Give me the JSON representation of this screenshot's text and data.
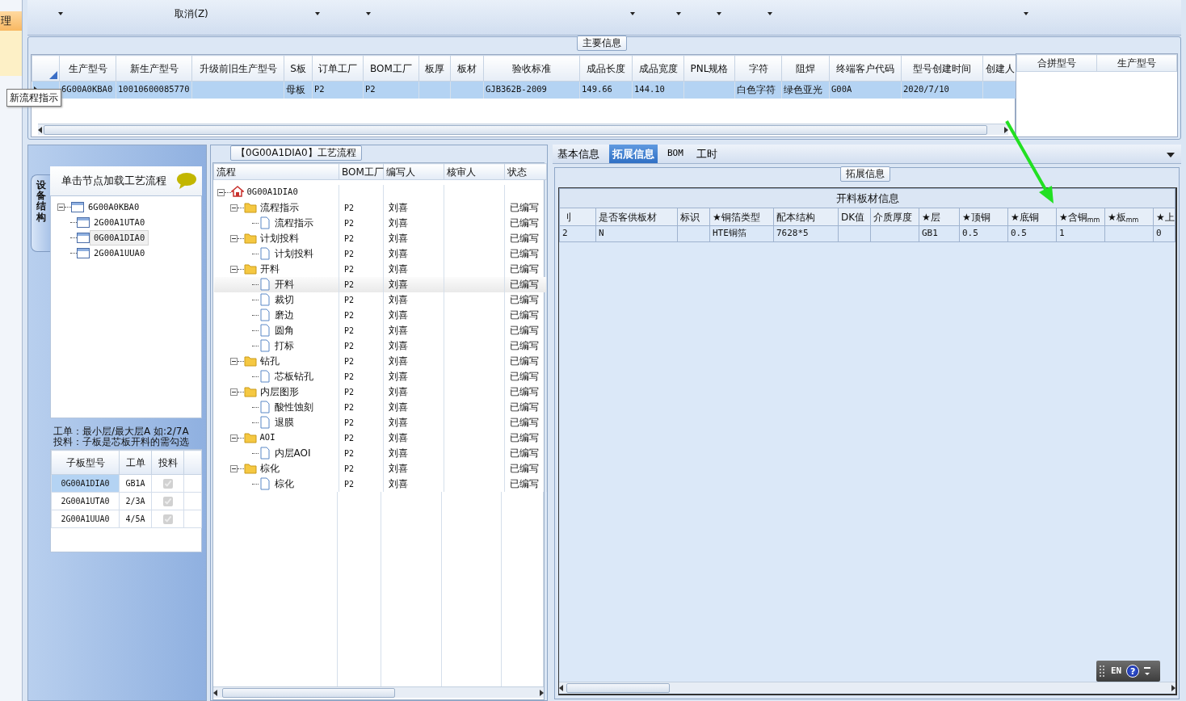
{
  "sidebar": {
    "items": [
      {
        "label": "理",
        "selected": true
      }
    ]
  },
  "toolbar": {
    "items": [
      {
        "label": "取消(Z)"
      }
    ]
  },
  "tooltip": "新流程指示",
  "main_info": {
    "title": "主要信息",
    "columns": [
      "生产型号",
      "新生产型号",
      "升级前旧生产型号",
      "S板",
      "订单工厂",
      "BOM工厂",
      "板厚",
      "板材",
      "验收标准",
      "成品长度",
      "成品宽度",
      "PNL规格",
      "字符",
      "阻焊",
      "终端客户代码",
      "型号创建时间",
      "创建人"
    ],
    "rows": [
      {
        "selected": true,
        "cells": [
          "6G00A0KBA0",
          "10010600085770",
          "",
          "母板",
          "P2",
          "P2",
          "",
          "",
          "GJB362B-2009",
          "149.66",
          "144.10",
          "",
          "白色字符",
          "绿色亚光",
          "G00A",
          "2020/7/10",
          ""
        ]
      }
    ]
  },
  "merge_table": {
    "columns": [
      "合拼型号",
      "生产型号"
    ]
  },
  "structure_panel": {
    "tab": "设备结构",
    "hint": "单击节点加载工艺流程",
    "tree": [
      {
        "label": "6G00A0KBA0",
        "expanded": true,
        "selected": false,
        "children": [
          {
            "label": "2G00A1UTA0",
            "selected": false
          },
          {
            "label": "0G00A1DIA0",
            "selected": true
          },
          {
            "label": "2G00A1UUA0",
            "selected": false
          }
        ]
      }
    ],
    "notes": [
      "工单：最小层/最大层A 如:2/7A",
      "投料：子板是芯板开料的需勾选"
    ],
    "sub_table": {
      "columns": [
        "子板型号",
        "工单",
        "投料"
      ],
      "rows": [
        {
          "cells": [
            "0G00A1DIA0",
            "GB1A"
          ],
          "checked": true,
          "disabled": true,
          "selected": true
        },
        {
          "cells": [
            "2G00A1UTA0",
            "2/3A"
          ],
          "checked": true,
          "disabled": true,
          "selected": false
        },
        {
          "cells": [
            "2G00A1UUA0",
            "4/5A"
          ],
          "checked": true,
          "disabled": true,
          "selected": false
        }
      ]
    }
  },
  "process_panel": {
    "title": "【0G00A1DIA0】工艺流程",
    "columns": [
      "流程",
      "BOM工厂",
      "编写人",
      "核审人",
      "状态"
    ],
    "tree": [
      {
        "label": "0G00A1DIA0",
        "kind": "root",
        "expanded": true,
        "selected": false,
        "children": [
          {
            "label": "流程指示",
            "kind": "folder",
            "bom": "P2",
            "writer": "刘喜",
            "status": "已编写",
            "expanded": true,
            "selected": false,
            "children": [
              {
                "label": "流程指示",
                "kind": "step",
                "bom": "P2",
                "writer": "刘喜",
                "status": "已编写",
                "selected": false
              }
            ]
          },
          {
            "label": "计划投料",
            "kind": "folder",
            "bom": "P2",
            "writer": "刘喜",
            "status": "已编写",
            "expanded": true,
            "selected": false,
            "children": [
              {
                "label": "计划投料",
                "kind": "step",
                "bom": "P2",
                "writer": "刘喜",
                "status": "已编写",
                "selected": false
              }
            ]
          },
          {
            "label": "开料",
            "kind": "folder",
            "bom": "P2",
            "writer": "刘喜",
            "status": "已编写",
            "expanded": true,
            "selected": false,
            "children": [
              {
                "label": "开料",
                "kind": "step",
                "bom": "P2",
                "writer": "刘喜",
                "status": "已编写",
                "selected": true
              },
              {
                "label": "裁切",
                "kind": "step",
                "bom": "P2",
                "writer": "刘喜",
                "status": "已编写",
                "selected": false
              },
              {
                "label": "磨边",
                "kind": "step",
                "bom": "P2",
                "writer": "刘喜",
                "status": "已编写",
                "selected": false
              },
              {
                "label": "圆角",
                "kind": "step",
                "bom": "P2",
                "writer": "刘喜",
                "status": "已编写",
                "selected": false
              },
              {
                "label": "打标",
                "kind": "step",
                "bom": "P2",
                "writer": "刘喜",
                "status": "已编写",
                "selected": false
              }
            ]
          },
          {
            "label": "钻孔",
            "kind": "folder",
            "bom": "P2",
            "writer": "刘喜",
            "status": "已编写",
            "expanded": true,
            "selected": false,
            "children": [
              {
                "label": "芯板钻孔",
                "kind": "step",
                "bom": "P2",
                "writer": "刘喜",
                "status": "已编写",
                "selected": false
              }
            ]
          },
          {
            "label": "内层图形",
            "kind": "folder",
            "bom": "P2",
            "writer": "刘喜",
            "status": "已编写",
            "expanded": true,
            "selected": false,
            "children": [
              {
                "label": "酸性蚀刻",
                "kind": "step",
                "bom": "P2",
                "writer": "刘喜",
                "status": "已编写",
                "selected": false
              },
              {
                "label": "退膜",
                "kind": "step",
                "bom": "P2",
                "writer": "刘喜",
                "status": "已编写",
                "selected": false
              }
            ]
          },
          {
            "label": "AOI",
            "kind": "folder",
            "bom": "P2",
            "writer": "刘喜",
            "status": "已编写",
            "expanded": true,
            "selected": false,
            "children": [
              {
                "label": "内层AOI",
                "kind": "step",
                "bom": "P2",
                "writer": "刘喜",
                "status": "已编写",
                "selected": false
              }
            ]
          },
          {
            "label": "棕化",
            "kind": "folder",
            "bom": "P2",
            "writer": "刘喜",
            "status": "已编写",
            "expanded": true,
            "selected": false,
            "children": [
              {
                "label": "棕化",
                "kind": "step",
                "bom": "P2",
                "writer": "刘喜",
                "status": "已编写",
                "selected": false
              }
            ]
          }
        ]
      }
    ]
  },
  "detail_panel": {
    "tabs": [
      {
        "label": "基本信息",
        "selected": false
      },
      {
        "label": "拓展信息",
        "selected": true
      },
      {
        "label": "BOM",
        "selected": false
      },
      {
        "label": "工时",
        "selected": false
      }
    ],
    "group_title": "拓展信息",
    "table": {
      "title": "开料板材信息",
      "columns": [
        "刂",
        "是否客供板材",
        "标识",
        "★铜箔类型",
        "配本结构",
        "DK值",
        "介质厚度",
        "★层",
        "★顶铜",
        "★底铜",
        "★含铜$_{mm}$",
        "★板$_{mm}$",
        "★上"
      ],
      "rows": [
        {
          "cells": [
            "2",
            "N",
            "",
            "HTE铜箔",
            "7628*5",
            "",
            "",
            "GB1",
            "0.5",
            "0.5",
            "1",
            "",
            "0"
          ]
        }
      ]
    }
  },
  "ime_bar": {
    "label": "EN",
    "help": "?"
  }
}
